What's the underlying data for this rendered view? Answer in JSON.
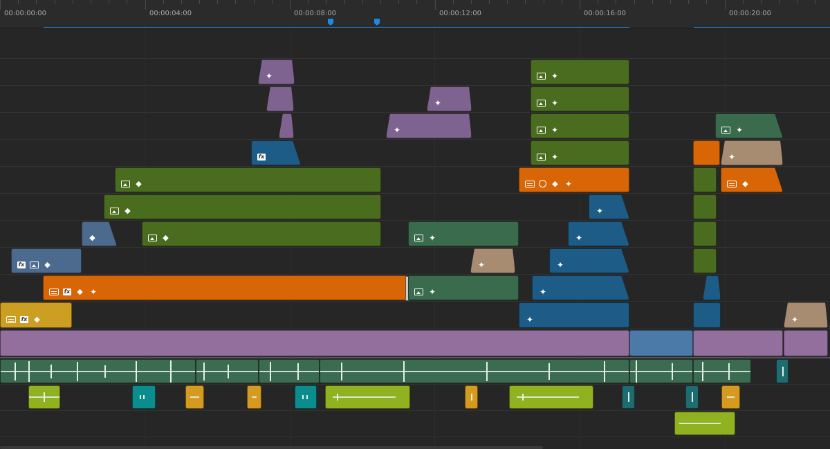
{
  "ruler": {
    "timecodes": [
      "00:00:00:00",
      "00:00:04:00",
      "00:00:08:00",
      "00:00:12:00",
      "00:00:16:00",
      "00:00:20:00"
    ]
  },
  "colors": {
    "background": "#262626",
    "ruler": "#2b2b2b",
    "marker": "#1e88e5",
    "purple": "#7e6390",
    "green": "#4a6c1e",
    "teal_green": "#3a6b4d",
    "blue": "#1c5c86",
    "steel": "#4b6a8e",
    "orange": "#d86607",
    "gold": "#cc9f23",
    "tan": "#a88c72",
    "lavender": "#936f9e",
    "lime": "#90b120",
    "cyan": "#0b8d8d",
    "yellow_orange": "#d59a20"
  },
  "icon_legend": {
    "sparkle": "✦",
    "keyframe": "◆",
    "fx": "fx"
  }
}
